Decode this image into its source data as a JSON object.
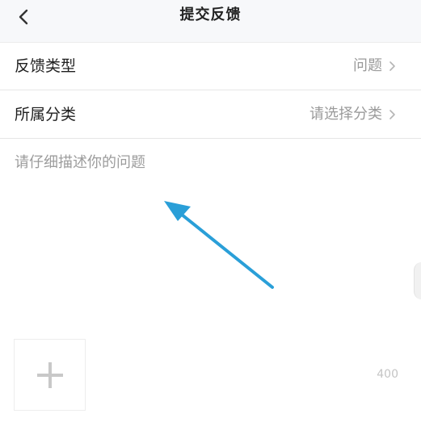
{
  "header": {
    "title": "提交反馈"
  },
  "form": {
    "rows": [
      {
        "label": "反馈类型",
        "value": "问题"
      },
      {
        "label": "所属分类",
        "value": "请选择分类"
      }
    ],
    "description_placeholder": "请仔细描述你的问题",
    "char_limit": "400"
  },
  "icons": {
    "back": "chevron-left-icon",
    "row_arrow": "chevron-right-icon",
    "add": "plus-icon"
  },
  "colors": {
    "annotation_arrow": "#2a9fd8",
    "header_bg": "#f7f8fa"
  }
}
